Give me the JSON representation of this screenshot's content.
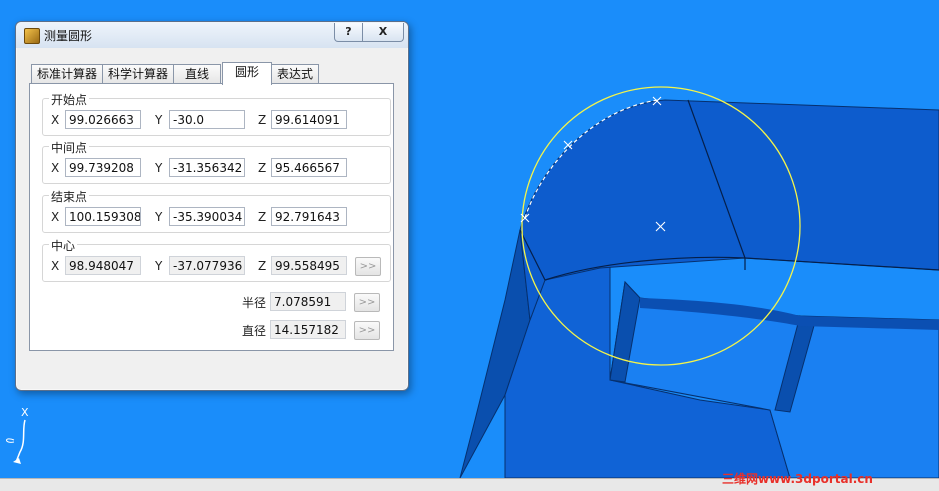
{
  "dialog": {
    "title": "测量圆形",
    "help_label": "?",
    "close_label": "X"
  },
  "tabs": [
    {
      "label": "标准计算器"
    },
    {
      "label": "科学计算器"
    },
    {
      "label": "直线"
    },
    {
      "label": "圆形",
      "active": true
    },
    {
      "label": "表达式"
    }
  ],
  "start_point": {
    "label": "开始点",
    "x_label": "X",
    "x": "99.026663",
    "y_label": "Y",
    "y": "-30.0",
    "z_label": "Z",
    "z": "99.614091"
  },
  "mid_point": {
    "label": "中间点",
    "x_label": "X",
    "x": "99.739208",
    "y_label": "Y",
    "y": "-31.356342",
    "z_label": "Z",
    "z": "95.466567"
  },
  "end_point": {
    "label": "结束点",
    "x_label": "X",
    "x": "100.159308",
    "y_label": "Y",
    "y": "-35.390034",
    "z_label": "Z",
    "z": "92.791643"
  },
  "center": {
    "label": "中心",
    "x_label": "X",
    "x": "98.948047",
    "y_label": "Y",
    "y": "-37.077936",
    "z_label": "Z",
    "z": "99.558495",
    "send_label": ">>"
  },
  "radius": {
    "label": "半径",
    "value": "7.078591",
    "send_label": ">>"
  },
  "diameter": {
    "label": "直径",
    "value": "14.157182",
    "send_label": ">>"
  },
  "triad": {
    "axis_label": "X"
  },
  "watermark": "三维网www.3dportal.cn",
  "colors": {
    "background": "#1a8dfa",
    "model": "#0b5cc7",
    "circle": "#f4f44a"
  }
}
